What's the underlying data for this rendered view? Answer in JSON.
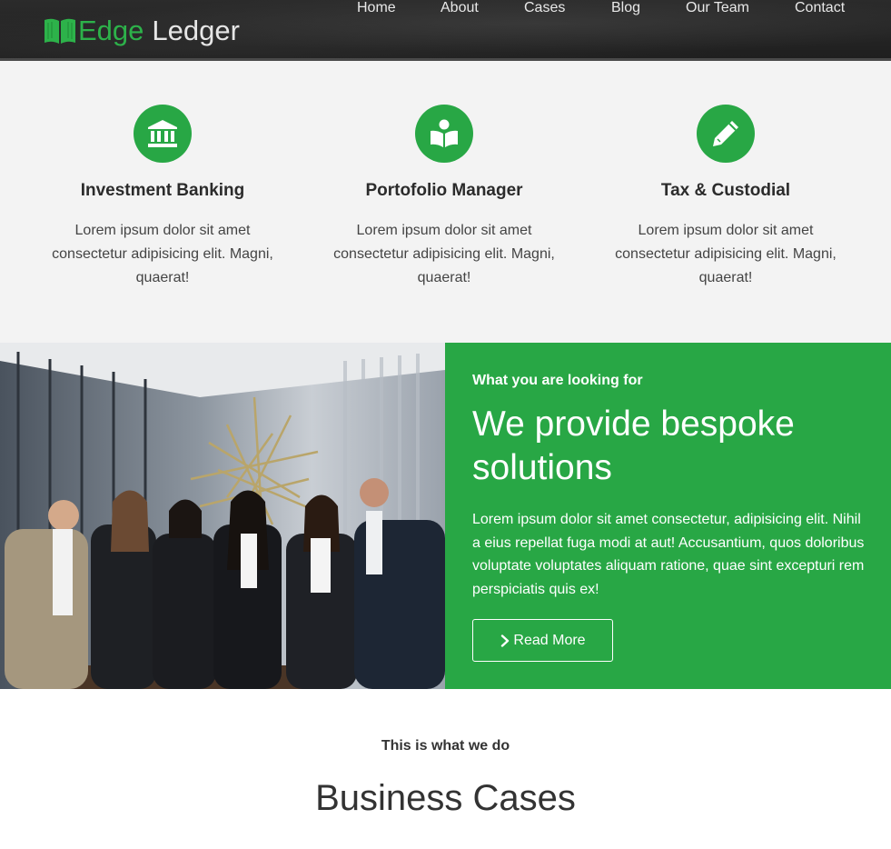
{
  "brand": {
    "word1": "Edge",
    "word2": "Ledger",
    "logo_icon": "open-book-icon"
  },
  "nav": {
    "items": [
      {
        "label": "Home"
      },
      {
        "label": "About"
      },
      {
        "label": "Cases"
      },
      {
        "label": "Blog"
      },
      {
        "label": "Our Team"
      },
      {
        "label": "Contact"
      }
    ]
  },
  "features": [
    {
      "icon": "bank-icon",
      "title": "Investment Banking",
      "text": "Lorem ipsum dolor sit amet consectetur adipisicing elit. Magni, quaerat!"
    },
    {
      "icon": "reader-icon",
      "title": "Portofolio Manager",
      "text": "Lorem ipsum dolor sit amet consectetur adipisicing elit. Magni, quaerat!"
    },
    {
      "icon": "pencil-icon",
      "title": "Tax & Custodial",
      "text": "Lorem ipsum dolor sit amet consectetur adipisicing elit. Magni, quaerat!"
    }
  ],
  "hero": {
    "kicker": "What you are looking for",
    "title": "We provide bespoke solutions",
    "body": "Lorem ipsum dolor sit amet consectetur, adipisicing elit. Nihil a eius repellat fuga modi at aut! Accusantium, quos doloribus voluptate voluptates aliquam ratione, quae sint excepturi rem perspiciatis quis ex!",
    "button_label": "Read More",
    "button_icon": "chevron-right-icon"
  },
  "cases": {
    "kicker": "This is what we do",
    "title": "Business Cases"
  },
  "colors": {
    "accent": "#28a745",
    "navbar": "#262626",
    "features_bg": "#f3f3f3"
  }
}
